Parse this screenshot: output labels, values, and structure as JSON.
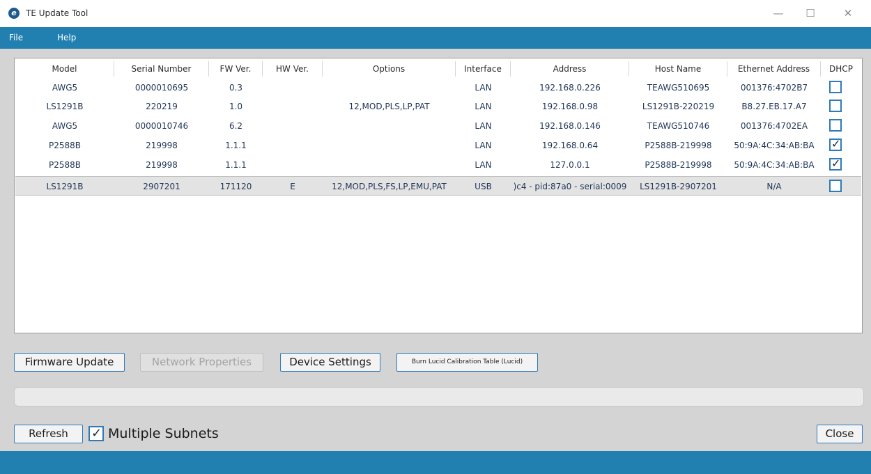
{
  "window": {
    "title": "TE Update Tool",
    "minimize_glyph": "—",
    "maximize_glyph": "☐",
    "close_glyph": "✕"
  },
  "menu": [
    "File",
    "Help"
  ],
  "columns": [
    "Model",
    "Serial Number",
    "FW Ver.",
    "HW Ver.",
    "Options",
    "Interface",
    "Address",
    "Host Name",
    "Ethernet Address",
    "DHCP"
  ],
  "rows": [
    {
      "model": "AWG5",
      "serial": "0000010695",
      "fw": "0.3",
      "hw": "",
      "options": "",
      "interface": "LAN",
      "address": "192.168.0.226",
      "host": "TEAWG510695",
      "ethernet": "001376:4702B7",
      "dhcp": false,
      "selected": false
    },
    {
      "model": "LS1291B",
      "serial": "220219",
      "fw": "1.0",
      "hw": "",
      "options": "12,MOD,PLS,LP,PAT",
      "interface": "LAN",
      "address": "192.168.0.98",
      "host": "LS1291B-220219",
      "ethernet": "B8.27.EB.17.A7",
      "dhcp": false,
      "selected": false
    },
    {
      "model": "AWG5",
      "serial": "0000010746",
      "fw": "6.2",
      "hw": "",
      "options": "",
      "interface": "LAN",
      "address": "192.168.0.146",
      "host": "TEAWG510746",
      "ethernet": "001376:4702EA",
      "dhcp": false,
      "selected": false
    },
    {
      "model": "P2588B",
      "serial": "219998",
      "fw": "1.1.1",
      "hw": "",
      "options": "",
      "interface": "LAN",
      "address": "192.168.0.64",
      "host": "P2588B-219998",
      "ethernet": "50:9A:4C:34:AB:BA",
      "dhcp": true,
      "selected": false
    },
    {
      "model": "P2588B",
      "serial": "219998",
      "fw": "1.1.1",
      "hw": "",
      "options": "",
      "interface": "LAN",
      "address": "127.0.0.1",
      "host": "P2588B-219998",
      "ethernet": "50:9A:4C:34:AB:BA",
      "dhcp": true,
      "selected": false
    },
    {
      "model": "LS1291B",
      "serial": "2907201",
      "fw": "171120",
      "hw": "E",
      "options": "12,MOD,PLS,FS,LP,EMU,PAT",
      "interface": "USB",
      "address": ")c4 - pid:87a0 - serial:0009",
      "host": "LS1291B-2907201",
      "ethernet": "N/A",
      "dhcp": false,
      "selected": true
    }
  ],
  "buttons": {
    "firmware_update": "Firmware Update",
    "network_properties": "Network Properties",
    "device_settings": "Device Settings",
    "burn_calibration": "Burn Lucid Calibration Table (Lucid)",
    "refresh": "Refresh",
    "close": "Close"
  },
  "progress": {
    "value": 0
  },
  "multiple_subnets": {
    "label": "Multiple Subnets",
    "checked": true
  },
  "colors": {
    "accent": "#2180b0",
    "border": "#2f7ab9",
    "text_blue": "#1f3555"
  },
  "icons": {
    "app": "te-logo-icon",
    "check": "✓"
  }
}
